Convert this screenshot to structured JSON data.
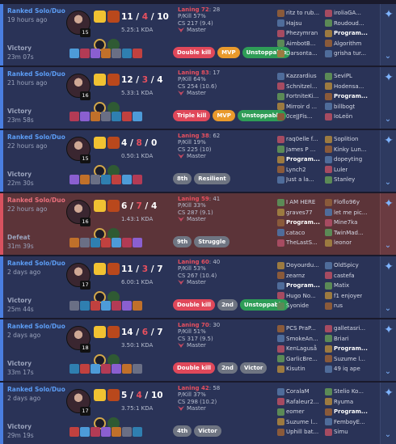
{
  "matches": [
    {
      "queue": "Ranked Solo/Duo",
      "ago": "19 hours ago",
      "result": "Victory",
      "duration": "23m 07s",
      "level": "15",
      "k": "11",
      "d": "4",
      "a": "10",
      "kda_ratio": "5.25:1 KDA",
      "lp_label": "Laning 72",
      "lp_val": ": 28",
      "pkill": "P/Kill 57%",
      "cs": "CS 217 (9.4)",
      "tier": "Master",
      "badges": [
        {
          "t": "Double kill",
          "c": "red"
        },
        {
          "t": "MVP",
          "c": "orange"
        },
        {
          "t": "Unstoppable",
          "c": "green"
        }
      ],
      "team1": [
        "ritz to rub...",
        "Hajsu",
        "Phezymran",
        "AimbotB...",
        "Darsonta..."
      ],
      "team2": [
        "iroliaGA...",
        "Roudoud...",
        "Program...",
        "Algorithm",
        "grisha tur..."
      ],
      "me_team": "team2",
      "me_index": 2,
      "outcome": "win"
    },
    {
      "queue": "Ranked Solo/Duo",
      "ago": "21 hours ago",
      "result": "Victory",
      "duration": "23m 58s",
      "level": "16",
      "k": "12",
      "d": "3",
      "a": "4",
      "kda_ratio": "5.33:1 KDA",
      "lp_label": "Laning 83",
      "lp_val": ": 17",
      "pkill": "P/Kill 64%",
      "cs": "CS 254 (10.6)",
      "tier": "Master",
      "badges": [
        {
          "t": "Triple kill",
          "c": "red"
        },
        {
          "t": "MVP",
          "c": "orange"
        },
        {
          "t": "Unstoppable",
          "c": "green"
        }
      ],
      "team1": [
        "Kazzardius",
        "Schnitzel...",
        "FortniteKi...",
        "Mirroir d ...",
        "0ceJJFis..."
      ],
      "team2": [
        "SeviPL",
        "Hodensa...",
        "Program...",
        "billbogt",
        "IoLeön"
      ],
      "me_team": "team2",
      "me_index": 2,
      "outcome": "win"
    },
    {
      "queue": "Ranked Solo/Duo",
      "ago": "22 hours ago",
      "result": "Victory",
      "duration": "22m 30s",
      "level": "15",
      "k": "4",
      "d": "8",
      "a": "0",
      "kda_ratio": "0.50:1 KDA",
      "lp_label": "Laning 38",
      "lp_val": ": 62",
      "pkill": "P/Kill 19%",
      "cs": "CS 225 (10)",
      "tier": "Master",
      "badges": [
        {
          "t": "8th",
          "c": "gray"
        },
        {
          "t": "Resilient",
          "c": "gray"
        }
      ],
      "team1": [
        "raq0elle f...",
        "James P ...",
        "Program...",
        "Lynch2",
        "Just a la..."
      ],
      "team2": [
        "Soplition",
        "Kinky Lun...",
        "dopeyting",
        "Luler",
        "Stanley"
      ],
      "me_team": "team1",
      "me_index": 2,
      "outcome": "win"
    },
    {
      "queue": "Ranked Solo/Duo",
      "ago": "22 hours ago",
      "result": "Defeat",
      "duration": "31m 39s",
      "level": "16",
      "k": "6",
      "d": "7",
      "a": "4",
      "kda_ratio": "1.43:1 KDA",
      "lp_label": "Laning 59",
      "lp_val": ": 41",
      "pkill": "P/Kill 33%",
      "cs": "CS 287 (9.1)",
      "tier": "Master",
      "badges": [
        {
          "t": "9th",
          "c": "gray"
        },
        {
          "t": "Struggle",
          "c": "gray"
        }
      ],
      "team1": [
        "I AM HERE",
        "graves77",
        "Program...",
        "cataco",
        "TheLastS..."
      ],
      "team2": [
        "Floflo96y",
        "let me pic...",
        "Mine7ka",
        "TwinMad...",
        "leonor"
      ],
      "me_team": "team1",
      "me_index": 2,
      "outcome": "loss"
    },
    {
      "queue": "Ranked Solo/Duo",
      "ago": "2 days ago",
      "result": "Victory",
      "duration": "25m 44s",
      "level": "17",
      "k": "11",
      "d": "3",
      "a": "7",
      "kda_ratio": "6.00:1 KDA",
      "lp_label": "Laning 60",
      "lp_val": ": 40",
      "pkill": "P/Kill 53%",
      "cs": "CS 267 (10.4)",
      "tier": "Master",
      "badges": [
        {
          "t": "Double kill",
          "c": "red"
        },
        {
          "t": "2nd",
          "c": "gray"
        },
        {
          "t": "Unstoppable",
          "c": "green"
        }
      ],
      "team1": [
        "Doyourdu...",
        "zearnz",
        "Program...",
        "Hugo No...",
        "Syonide"
      ],
      "team2": [
        "OldSpicy",
        "castefa",
        "Matix",
        "f1 enjoyer",
        "rus"
      ],
      "me_team": "team1",
      "me_index": 2,
      "outcome": "win"
    },
    {
      "queue": "Ranked Solo/Duo",
      "ago": "2 days ago",
      "result": "Victory",
      "duration": "33m 17s",
      "level": "18",
      "k": "14",
      "d": "6",
      "a": "7",
      "kda_ratio": "3.50:1 KDA",
      "lp_label": "Laning 70",
      "lp_val": ": 30",
      "pkill": "P/Kill 51%",
      "cs": "CS 317 (9.5)",
      "tier": "Master",
      "badges": [
        {
          "t": "Double kill",
          "c": "red"
        },
        {
          "t": "2nd",
          "c": "gray"
        },
        {
          "t": "Victor",
          "c": "gray"
        }
      ],
      "team1": [
        "PCS PraP...",
        "SmokeAn...",
        "KenLaguså",
        "GarlicBre...",
        "Kisutin"
      ],
      "team2": [
        "galletasri...",
        "Briari",
        "Program...",
        "Suzume l...",
        "49 iq ape"
      ],
      "me_team": "team2",
      "me_index": 2,
      "outcome": "win"
    },
    {
      "queue": "Ranked Solo/Duo",
      "ago": "2 days ago",
      "result": "Victory",
      "duration": "29m 19s",
      "level": "17",
      "k": "5",
      "d": "4",
      "a": "10",
      "kda_ratio": "3.75:1 KDA",
      "lp_label": "Laning 42",
      "lp_val": ": 58",
      "pkill": "P/Kill 37%",
      "cs": "CS 298 (10.2)",
      "tier": "Master",
      "badges": [
        {
          "t": "4th",
          "c": "gray"
        },
        {
          "t": "Victor",
          "c": "gray"
        }
      ],
      "team1": [
        "CoralaM",
        "Rafaleur2...",
        "eomer",
        "Suzume l...",
        "Uphill bat..."
      ],
      "team2": [
        "Stelio Ko...",
        "Ryuma",
        "Program...",
        "FemboyE...",
        "Simu"
      ],
      "me_team": "team2",
      "me_index": 2,
      "outcome": "win"
    }
  ],
  "item_colors": [
    "#4d9bd8",
    "#b33b55",
    "#8a5fd0",
    "#c0702a",
    "#6a6f85",
    "#2f7fb0",
    "#c1413f"
  ],
  "pic_colors": [
    "#8a5a3a",
    "#4f6c9a",
    "#a64b61",
    "#5b8a56",
    "#9c7a40"
  ],
  "icons": {
    "add": "add-friend-icon",
    "expand": "chevron-down-icon"
  }
}
